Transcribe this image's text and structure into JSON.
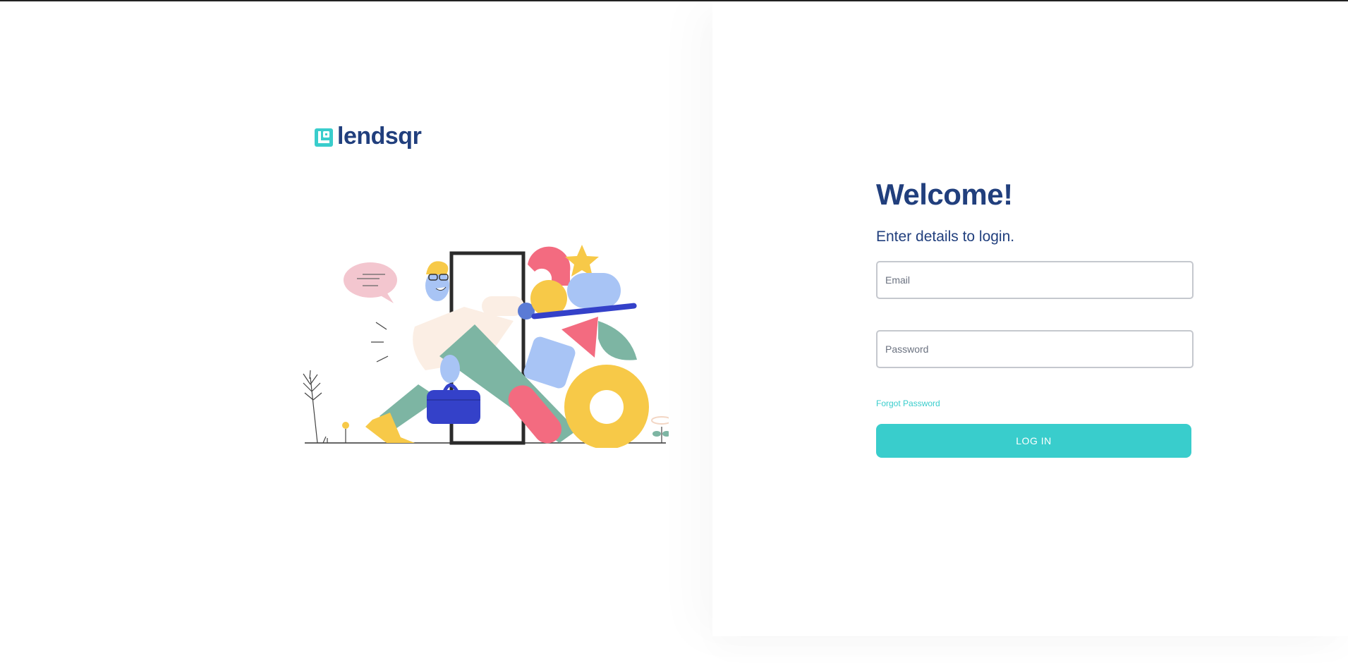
{
  "brand": {
    "name": "lendsqr",
    "color": "#213f7d",
    "mark_color": "#39cdcc"
  },
  "login": {
    "heading": "Welcome!",
    "subheading": "Enter details to login.",
    "email_placeholder": "Email",
    "password_placeholder": "Password",
    "forgot_label": "Forgot Password",
    "submit_label": "LOG IN",
    "accent": "#39cdcc"
  },
  "illustration": {
    "icons": [
      "person-icon",
      "door-icon",
      "speech-bubble-icon",
      "briefcase-icon",
      "star-icon",
      "plant-icon"
    ]
  }
}
